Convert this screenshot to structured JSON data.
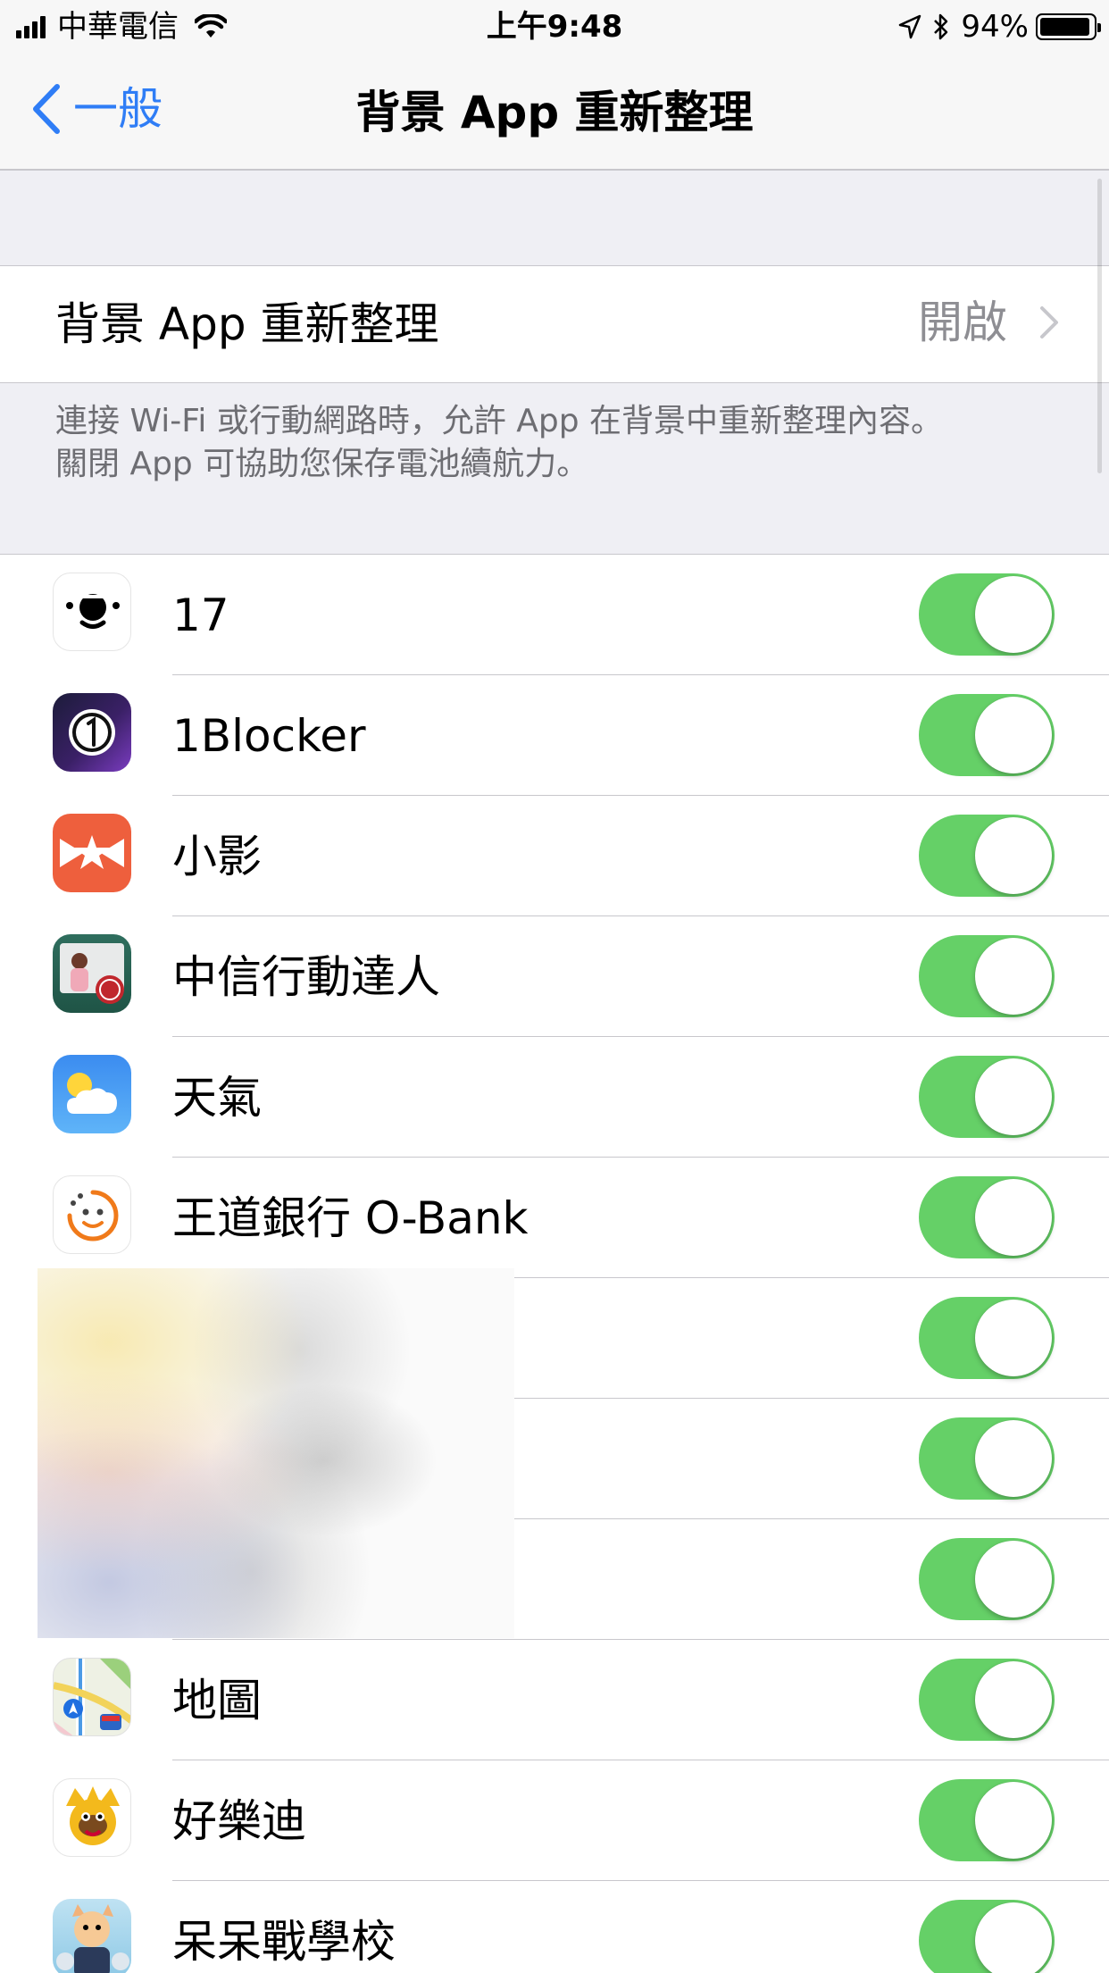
{
  "status_bar": {
    "carrier": "中華電信",
    "time": "上午9:48",
    "battery_percent": "94%",
    "battery_level": 0.94,
    "icons": [
      "signal-icon",
      "wifi-icon",
      "location-icon",
      "bluetooth-icon",
      "battery-icon"
    ]
  },
  "nav": {
    "back_label": "一般",
    "title": "背景 App 重新整理"
  },
  "refresh_setting": {
    "label": "背景 App 重新整理",
    "value": "開啟"
  },
  "footnote": {
    "line1": "連接 Wi-Fi 或行動網路時，允許 App 在背景中重新整理內容。",
    "line2": "關閉 App 可協助您保存電池續航力。"
  },
  "apps": [
    {
      "name": "17",
      "icon": "app-17-icon",
      "enabled": true
    },
    {
      "name": "1Blocker",
      "icon": "app-1blocker-icon",
      "enabled": true
    },
    {
      "name": "小影",
      "icon": "app-xiaoying-icon",
      "enabled": true
    },
    {
      "name": "中信行動達人",
      "icon": "app-ctbc-icon",
      "enabled": true
    },
    {
      "name": "天氣",
      "icon": "app-weather-icon",
      "enabled": true
    },
    {
      "name": "王道銀行 O-Bank",
      "icon": "app-obank-icon",
      "enabled": true
    },
    {
      "name": "",
      "icon": "blurred-app-icon",
      "enabled": true
    },
    {
      "name": "",
      "icon": "blurred-app-icon",
      "enabled": true
    },
    {
      "name": "",
      "icon": "blurred-app-icon",
      "enabled": true
    },
    {
      "name": "地圖",
      "icon": "app-maps-icon",
      "enabled": true
    },
    {
      "name": "好樂迪",
      "icon": "app-holiday-icon",
      "enabled": true
    },
    {
      "name": "呆呆戰學校",
      "icon": "app-school-icon",
      "enabled": true
    }
  ],
  "colors": {
    "tint": "#2f7df6",
    "toggle_on": "#65d067",
    "separator": "#c8c7cc",
    "group_background": "#efeff4"
  }
}
